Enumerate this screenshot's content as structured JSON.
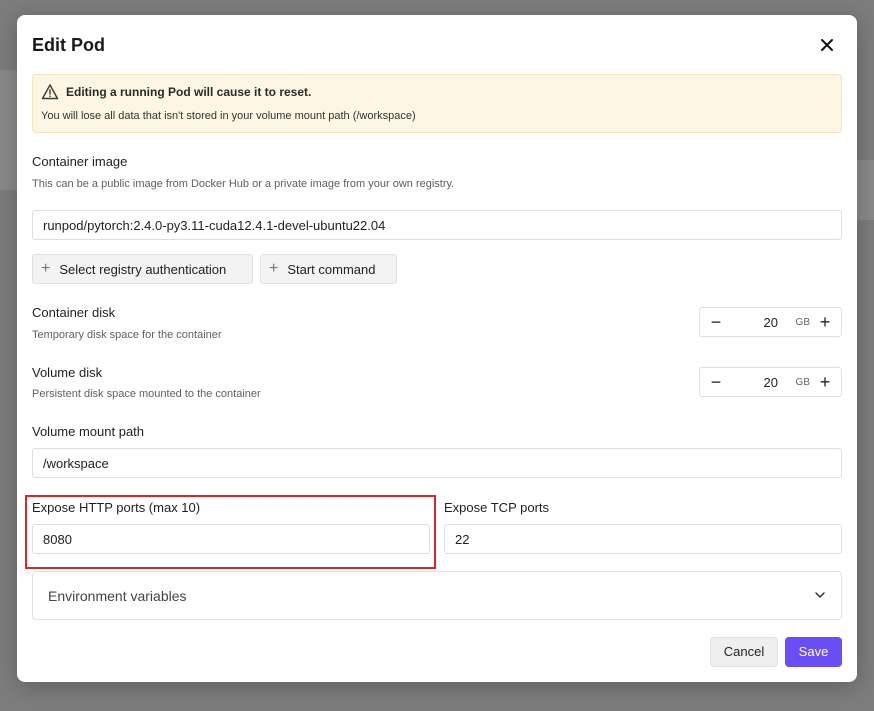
{
  "dialog": {
    "title": "Edit Pod"
  },
  "alert": {
    "title": "Editing a running Pod will cause it to reset.",
    "text": "You will lose all data that isn't stored in your volume mount path (/workspace)",
    "color": "#fdf6e3"
  },
  "container_image": {
    "label": "Container image",
    "help": "This can be a public image from Docker Hub or a private image from your own registry.",
    "value": "runpod/pytorch:2.4.0-py3.11-cuda12.4.1-devel-ubuntu22.04"
  },
  "actions": {
    "registry_auth": "Select registry authentication",
    "start_command": "Start command"
  },
  "container_disk": {
    "label": "Container disk",
    "help": "Temporary disk space for the container",
    "value": "20",
    "unit": "GB"
  },
  "volume_disk": {
    "label": "Volume disk",
    "help": "Persistent disk space mounted to the container",
    "value": "20",
    "unit": "GB"
  },
  "volume_mount": {
    "label": "Volume mount path",
    "value": "/workspace"
  },
  "http_ports": {
    "label": "Expose HTTP ports (max 10)",
    "value": "8080"
  },
  "tcp_ports": {
    "label": "Expose TCP ports",
    "value": "22"
  },
  "env": {
    "label": "Environment variables"
  },
  "footer": {
    "cancel": "Cancel",
    "save": "Save",
    "accent": "#6b4ef6"
  },
  "icons": {
    "close": "close-icon",
    "warning": "warning-icon",
    "plus": "plus-icon",
    "minus": "minus-icon",
    "chevron": "chevron-down-icon"
  }
}
